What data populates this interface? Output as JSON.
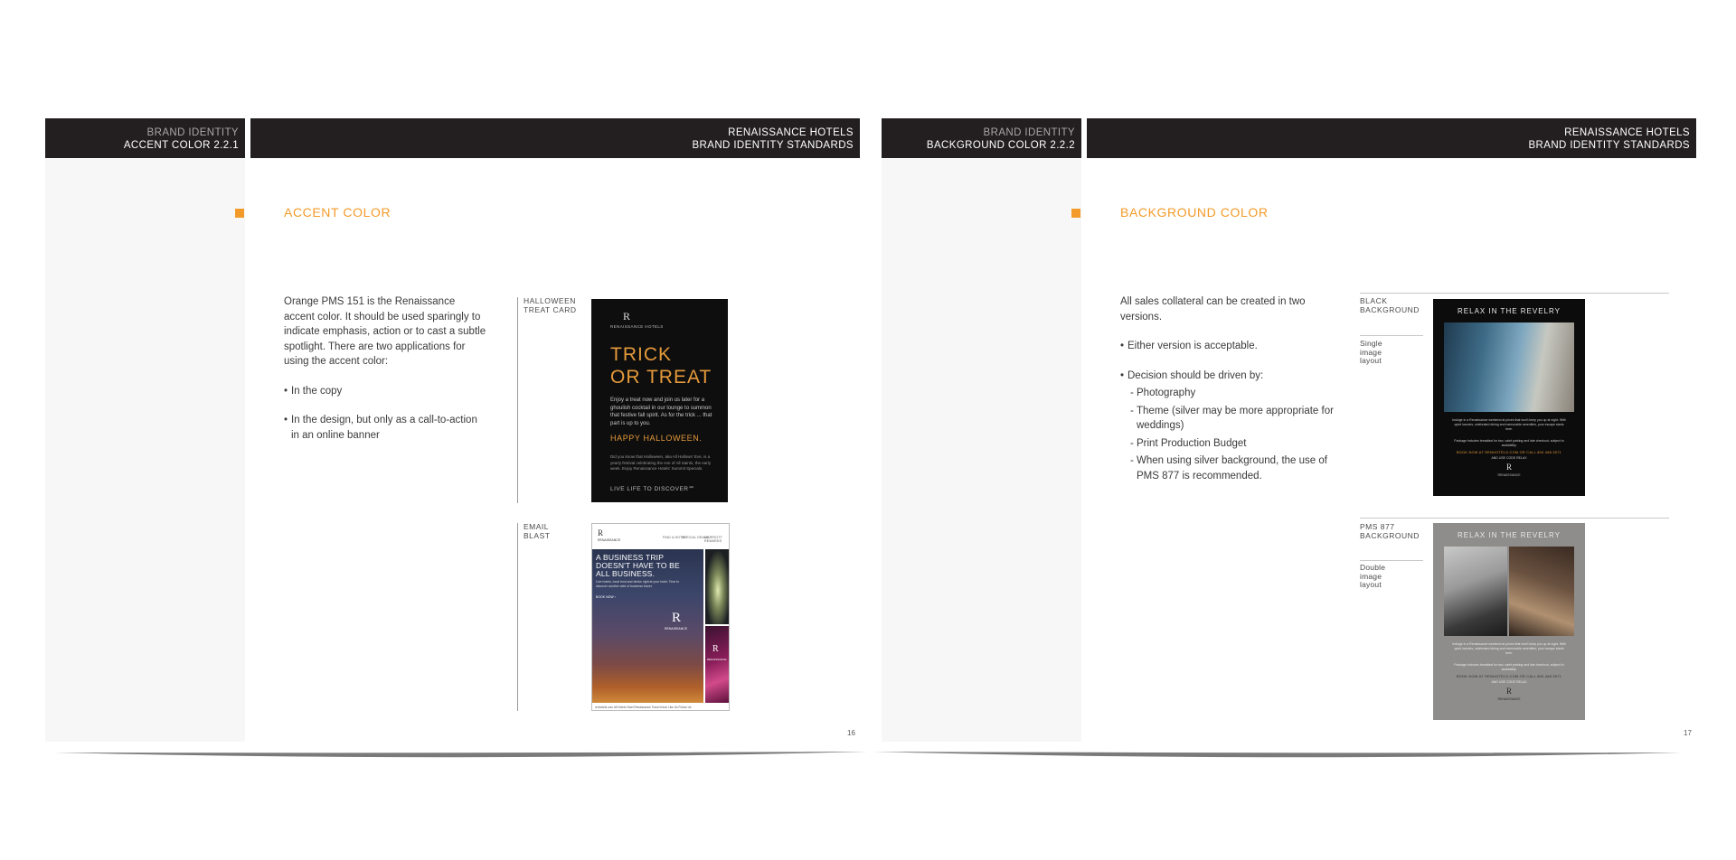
{
  "left_page": {
    "header_left": {
      "line1": "BRAND IDENTITY",
      "line2": "ACCENT COLOR  2.2.1"
    },
    "header_right": {
      "line1": "RENAISSANCE HOTELS",
      "line2": "BRAND IDENTITY STANDARDS"
    },
    "section_title": "ACCENT COLOR",
    "intro": "Orange PMS 151 is the Renaissance accent color. It should be used sparingly to indicate emphasis, action or to cast a subtle spotlight. There are two applications for using the accent color:",
    "bullets": [
      "In the copy",
      "In the design, but only as a call-to-action in an online banner"
    ],
    "bullet_char": "•",
    "figure1_label": [
      "HALLOWEEN",
      "TREAT CARD"
    ],
    "figure2_label": [
      "EMAIL",
      "BLAST"
    ],
    "page_number": "16",
    "halloween_card": {
      "logo": "R",
      "logo_sub": "RENAISSANCE\nHOTELS",
      "title_line1": "TRICK",
      "title_line2": "OR TREAT",
      "body": "Enjoy a treat now and join us later for a ghoulish cocktail in our lounge to summon that festive fall spirit. As for the trick ... that part is up to you.",
      "happy": "HAPPY HALLOWEEN.",
      "fine": "Did you know that Halloween, aka All Hallows' Eve, is a yearly festival celebrating the eve of All Saints, the early week. Enjoy Renaissance Hotels' Summit Specials.",
      "tagline": "LIVE LIFE TO DISCOVER℠"
    },
    "email_blast": {
      "logo": "R",
      "logo_sub": "RENAISSANCE",
      "nav": [
        "FIND A HOTEL",
        "SPECIAL DEALS",
        "MARRIOTT REWARDS"
      ],
      "headline_line1": "A BUSINESS TRIP",
      "headline_line2": "DOESN'T HAVE TO BE",
      "headline_line3": "ALL BUSINESS.",
      "sub": "Live hotels, local food and drinks right at your hotel. Time to discover another side of business travel.",
      "button": "BOOK NOW ›",
      "hero_logo": "R",
      "hero_logo_sub": "RENAISSANCE",
      "pink_logo": "R",
      "pink_logo_sub": "RENAISSANCE",
      "footer": "renhotels.com    All Hotels    Hotel Renaissance    Travel Inbox    Like Us    Follow Us"
    }
  },
  "right_page": {
    "header_left": {
      "line1": "BRAND IDENTITY",
      "line2": "BACKGROUND COLOR  2.2.2"
    },
    "header_right": {
      "line1": "RENAISSANCE HOTELS",
      "line2": "BRAND IDENTITY STANDARDS"
    },
    "section_title": "BACKGROUND COLOR",
    "intro": "All sales collateral can be created in two versions.",
    "bullet1": "Either version is acceptable.",
    "bullet2": "Decision should be driven by:",
    "bullet_char": "•",
    "dash_char": "-",
    "sub_items": [
      "Photography",
      "Theme (silver may be more appropriate for weddings)",
      "Print Production Budget",
      "When using silver background, the use of PMS 877 is recommended."
    ],
    "figure1_label": [
      "BLACK",
      "BACKGROUND"
    ],
    "figure1_sub": [
      "Single",
      "image",
      "layout"
    ],
    "figure2_label": [
      "PMS 877",
      "BACKGROUND"
    ],
    "figure2_sub": [
      "Double",
      "image",
      "layout"
    ],
    "page_number": "17",
    "ad": {
      "title": "RELAX IN THE REVELRY",
      "fine": "Indulge in a Renaissance weekend at prices that won't keep you up at night. With quiet luxuries, celebrated dining and memorable amenities, your escape starts here.",
      "fine2": "Package includes breakfast for two, valet parking and late checkout, subject to availability.",
      "book": "BOOK NOW AT RENHOTELS.COM OR CALL 800.468.3571",
      "sub_link": "AND USE CODE RELAX",
      "logo": "R",
      "logo_sub": "RENAISSANCE"
    }
  },
  "colors": {
    "accent": "#f39b2a",
    "header_bg": "#231f20",
    "sidebar_bg": "#f6f7f6"
  }
}
